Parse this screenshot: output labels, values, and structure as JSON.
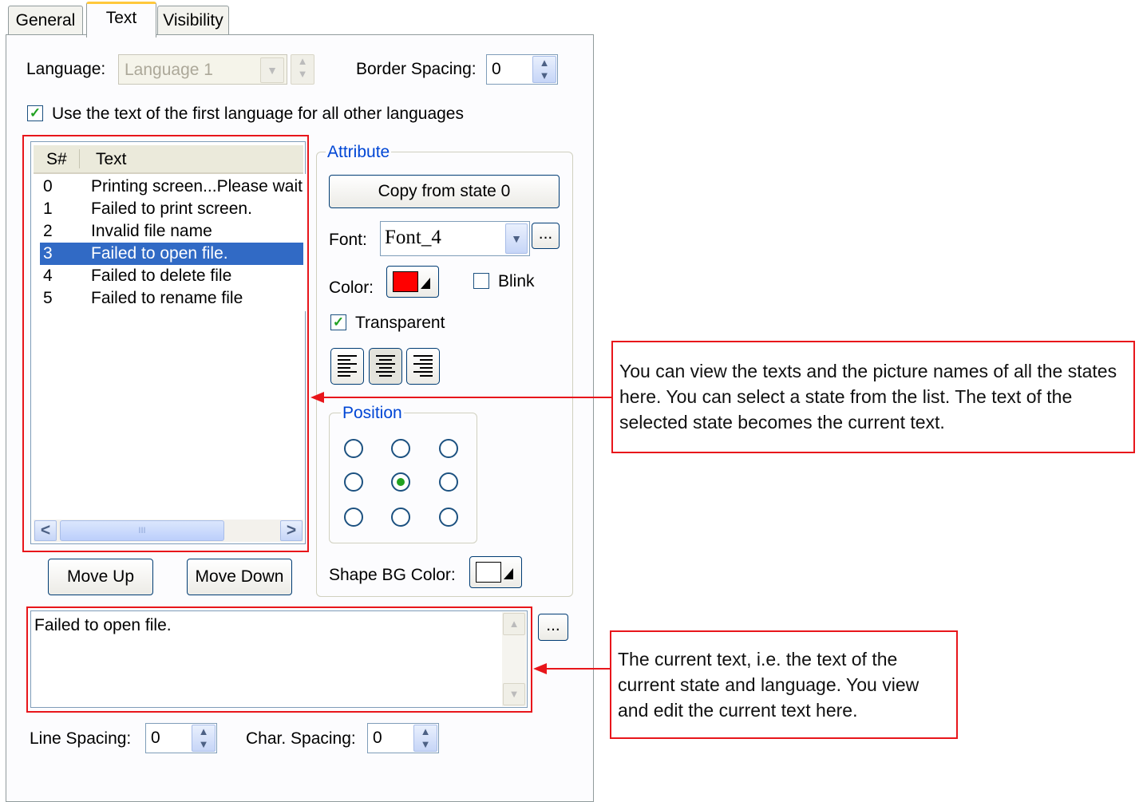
{
  "tabs": [
    {
      "label": "General"
    },
    {
      "label": "Text"
    },
    {
      "label": "Visibility"
    }
  ],
  "language": {
    "label": "Language:",
    "value": "Language 1"
  },
  "border_spacing": {
    "label": "Border Spacing:",
    "value": "0"
  },
  "use_first_language": {
    "label": "Use the text of the first language for all other languages",
    "checked": true
  },
  "state_list": {
    "headers": {
      "num": "S#",
      "text": "Text"
    },
    "rows": [
      {
        "num": "0",
        "text": "Printing screen...Please wait"
      },
      {
        "num": "1",
        "text": "Failed to print screen."
      },
      {
        "num": "2",
        "text": "Invalid file name"
      },
      {
        "num": "3",
        "text": "Failed to open file."
      },
      {
        "num": "4",
        "text": "Failed to delete file"
      },
      {
        "num": "5",
        "text": "Failed to rename file"
      }
    ],
    "selected_index": 3,
    "scroll_left": "<",
    "scroll_right": ">",
    "scroll_grip": "III"
  },
  "buttons": {
    "move_up": "Move Up",
    "move_down": "Move Down",
    "ellipsis": "...",
    "copy_state": "Copy from state 0"
  },
  "attribute": {
    "group_label": "Attribute",
    "font_label": "Font:",
    "font_value": "Font_4",
    "color_label": "Color:",
    "color_value": "#ff0000",
    "blink_label": "Blink",
    "blink_checked": false,
    "transparent_label": "Transparent",
    "transparent_checked": true,
    "position_label": "Position",
    "position_selected": 4,
    "shape_bg_label": "Shape BG Color:",
    "shape_bg_value": "#ffffff"
  },
  "current_text": "Failed to open file.",
  "line_spacing": {
    "label": "Line Spacing:",
    "value": "0"
  },
  "char_spacing": {
    "label": "Char. Spacing:",
    "value": "0"
  },
  "callouts": {
    "list": "You can view the texts and the picture names of all the states here. You can select a state from the list. The text of the selected state becomes the current text.",
    "text": "The current text, i.e. the text of the current state and language. You view and edit the current text here."
  },
  "colors": {
    "annotation_red": "#e8161b",
    "selection_blue": "#316ac5",
    "group_label_blue": "#0046d5"
  }
}
